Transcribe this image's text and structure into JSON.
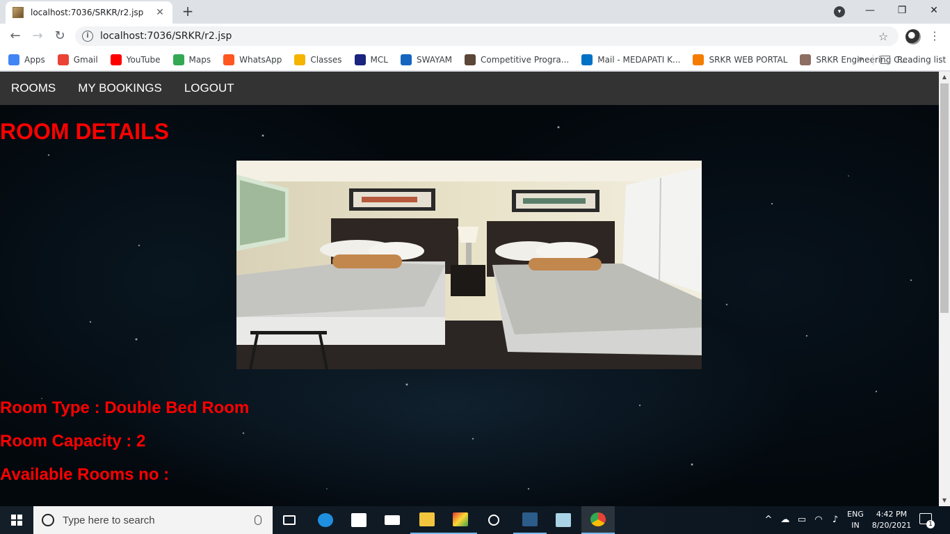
{
  "browser": {
    "tab_title": "localhost:7036/SRKR/r2.jsp",
    "tab_close": "✕",
    "new_tab": "+",
    "minimize": "—",
    "restore": "❐",
    "close": "✕",
    "url": "localhost:7036/SRKR/r2.jsp",
    "back": "←",
    "forward": "→",
    "reload": "↻"
  },
  "bookmarks": {
    "items": [
      {
        "label": "Apps",
        "icon": "apps-grid-icon",
        "color": "#4285f4"
      },
      {
        "label": "Gmail",
        "icon": "gmail-icon",
        "color": "#ea4335"
      },
      {
        "label": "YouTube",
        "icon": "youtube-icon",
        "color": "#ff0000"
      },
      {
        "label": "Maps",
        "icon": "maps-pin-icon",
        "color": "#34a853"
      },
      {
        "label": "WhatsApp",
        "icon": "whatsapp-icon",
        "color": "#ff5722"
      },
      {
        "label": "Classes",
        "icon": "classroom-icon",
        "color": "#f4b400"
      },
      {
        "label": "MCL",
        "icon": "mcl-icon",
        "color": "#1a237e"
      },
      {
        "label": "SWAYAM",
        "icon": "swayam-icon",
        "color": "#1565c0"
      },
      {
        "label": "Competitive Progra...",
        "icon": "codechef-icon",
        "color": "#5b4638"
      },
      {
        "label": "Mail - MEDAPATI K...",
        "icon": "outlook-icon",
        "color": "#0072c6"
      },
      {
        "label": "SRKR WEB PORTAL",
        "icon": "srkr-portal-icon",
        "color": "#f57c00"
      },
      {
        "label": "SRKR Engineering C...",
        "icon": "srkr-college-icon",
        "color": "#8d6e63"
      }
    ],
    "more": "»",
    "reading_list": "Reading list"
  },
  "nav": {
    "rooms": "ROOMS",
    "my_bookings": "MY BOOKINGS",
    "logout": "LOGOUT"
  },
  "page": {
    "title": "ROOM DETAILS",
    "room_type": "Room Type : Double Bed Room",
    "room_capacity": "Room Capacity : 2",
    "available_rooms": "Available Rooms no :"
  },
  "colors": {
    "heading": "#ff0000",
    "navbar_bg": "#333333",
    "page_bg": "#03080d"
  },
  "taskbar": {
    "search_placeholder": "Type here to search",
    "lang_line1": "ENG",
    "lang_line2": "IN",
    "time": "4:42 PM",
    "date": "8/20/2021",
    "notification_count": "1"
  }
}
